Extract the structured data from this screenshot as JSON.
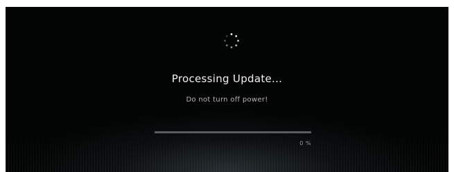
{
  "update_screen": {
    "title": "Processing Update...",
    "message": "Do not turn off power!",
    "progress": {
      "fraction": 0,
      "label": "0 %"
    }
  },
  "colors": {
    "background": "#030404",
    "title_text": "#f2f2f2",
    "message_text": "#b8b8b8",
    "progress_track": "#5a5d5f",
    "progress_fill": "#d9d9d9"
  },
  "icons": {
    "spinner": "loading-spinner-icon"
  }
}
